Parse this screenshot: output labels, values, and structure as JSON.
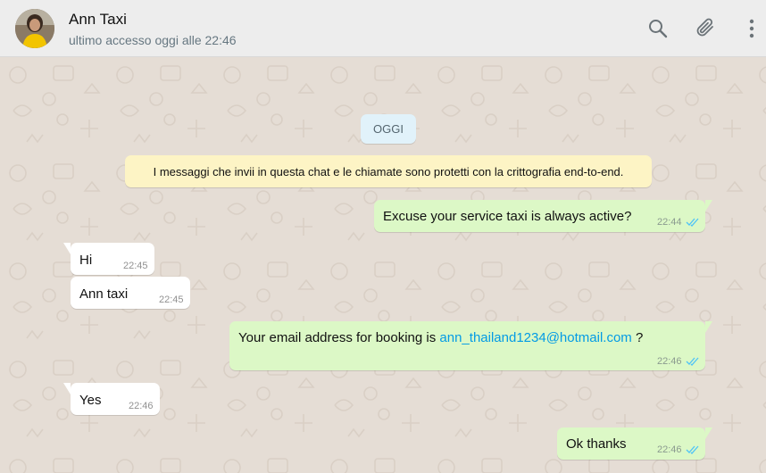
{
  "contact": {
    "name": "Ann Taxi",
    "status": "ultimo accesso oggi alle 22:46"
  },
  "header_icons": [
    "search-icon",
    "attach-icon",
    "menu-icon"
  ],
  "date_chip": "OGGI",
  "system_message": "I messaggi che invii in questa chat e le chiamate sono protetti con la crittografia end-to-end.",
  "messages": [
    {
      "direction": "out",
      "text": "Excuse your service taxi is always active?",
      "time": "22:44",
      "read": true
    },
    {
      "direction": "in",
      "text": "Hi",
      "time": "22:45"
    },
    {
      "direction": "in",
      "text": "Ann taxi",
      "time": "22:45"
    },
    {
      "direction": "out",
      "text_before": "Your email address for booking is ",
      "link": "ann_thailand1234@hotmail.com",
      "text_after": " ?",
      "time": "22:46",
      "read": true
    },
    {
      "direction": "in",
      "text": "Yes",
      "time": "22:46"
    },
    {
      "direction": "out",
      "text": "Ok thanks",
      "time": "22:46",
      "read": true
    }
  ],
  "colors": {
    "header_bg": "#ededed",
    "chat_bg": "#e5ddd5",
    "outgoing_bubble": "#dcf8c6",
    "incoming_bubble": "#ffffff",
    "read_ticks": "#4fc3f7",
    "link": "#039be5",
    "system_bg": "#fdf4c5",
    "date_chip_bg": "#e1f2fa"
  }
}
